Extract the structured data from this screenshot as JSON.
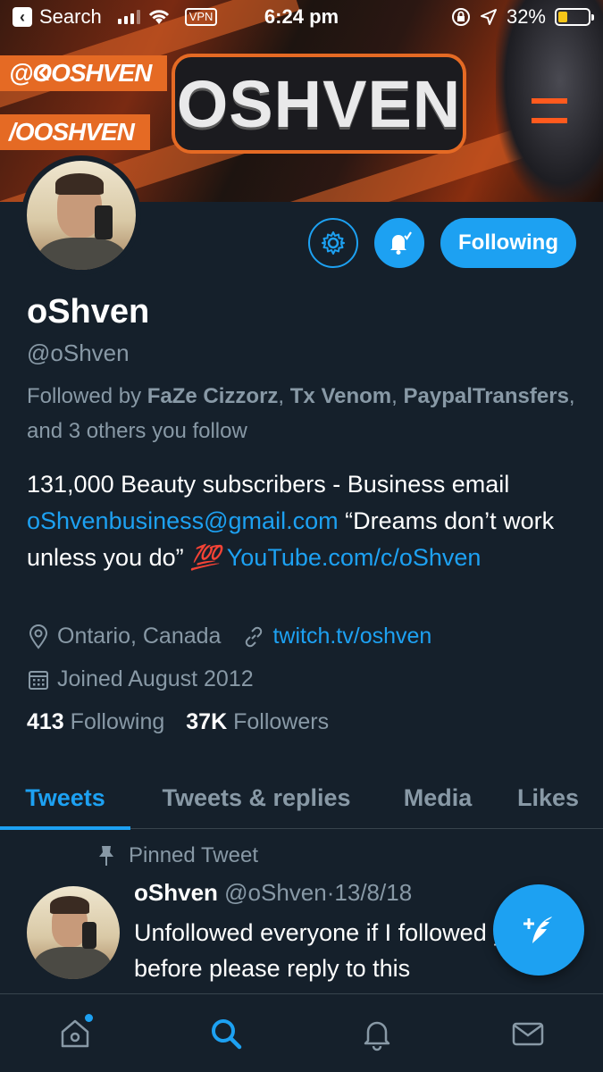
{
  "status_bar": {
    "back_label": "Search",
    "vpn": "VPN",
    "time": "6:24 pm",
    "battery": "32%",
    "battery_color": "#f5c518"
  },
  "banner": {
    "tag_twitter": "@OOSHVEN",
    "tag_youtube": "/OOSHVEN",
    "logo_text": "OSHVEN",
    "accent": "#e56a24"
  },
  "profile": {
    "name": "oShven",
    "handle": "@oShven",
    "followed_by": {
      "prefix": "Followed by",
      "user1": "FaZe Cizzorz",
      "user2": "Tx Venom",
      "user3": "PaypalTransfers",
      "suffix": ", and 3 others you follow"
    },
    "bio": {
      "line1": "131,000 Beauty subscribers - Business email",
      "email": "oShvenbusiness@gmail.com",
      "quote": "“Dreams don’t work unless you do”",
      "emoji": "💯",
      "url": "YouTube.com/c/oShven"
    },
    "location": "Ontario, Canada",
    "website": "twitch.tv/oshven",
    "joined": "Joined August 2012",
    "following_count": "413",
    "following_label": "Following",
    "followers_count": "37K",
    "followers_label": "Followers"
  },
  "actions": {
    "settings_icon": "gear-icon",
    "notify_icon": "bell-check-icon",
    "follow_label": "Following",
    "accent": "#1da1f2"
  },
  "tabs": [
    {
      "label": "Tweets",
      "active": true
    },
    {
      "label": "Tweets & replies",
      "active": false
    },
    {
      "label": "Media",
      "active": false
    },
    {
      "label": "Likes",
      "active": false
    }
  ],
  "pinned_tweet": {
    "pinned_label": "Pinned Tweet",
    "author": "oShven",
    "handle": "@oShven",
    "separator": "·",
    "date": "13/8/18",
    "text": "Unfollowed everyone if I followed you before please reply to this"
  },
  "bottom_nav": [
    {
      "icon": "home-icon",
      "active": false,
      "badge": true
    },
    {
      "icon": "search-icon",
      "active": true,
      "badge": false
    },
    {
      "icon": "bell-icon",
      "active": false,
      "badge": false
    },
    {
      "icon": "mail-icon",
      "active": false,
      "badge": false
    }
  ]
}
